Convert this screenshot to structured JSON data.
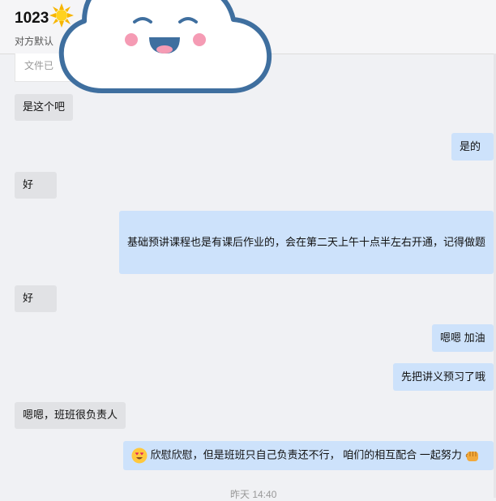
{
  "header": {
    "title": "1023",
    "subtitle_visible": "对方默认",
    "file_preview_visible": "文件已"
  },
  "messages": [
    {
      "side": "in",
      "text": "是这个吧"
    },
    {
      "side": "out",
      "text": "是的"
    },
    {
      "side": "in",
      "text": "好"
    },
    {
      "side": "out",
      "text": "基础预讲课程也是有课后作业的，会在第二天上午十点半左右开通，记得做题"
    },
    {
      "side": "in",
      "text": "好"
    },
    {
      "side": "out",
      "text": "嗯嗯 加油"
    },
    {
      "side": "out",
      "text": "先把讲义预习了哦"
    },
    {
      "side": "in",
      "text": "嗯嗯，班班很负责人"
    },
    {
      "side": "out",
      "text": "欣慰欣慰，但是班班只自己负责还不行， 咱们的相互配合 一起努力"
    }
  ],
  "timestamp": "昨天 14:40",
  "colors": {
    "incoming_bubble": "#e1e2e5",
    "outgoing_bubble": "#cde2fb",
    "background": "#f0f1f4",
    "cloud_outline": "#3f6f9f"
  },
  "icons": {
    "title_emoji": "sun-icon",
    "message_9_leading": "smiling-heart-eyes-emoji",
    "message_9_trailing": "raised-fist-emoji"
  }
}
